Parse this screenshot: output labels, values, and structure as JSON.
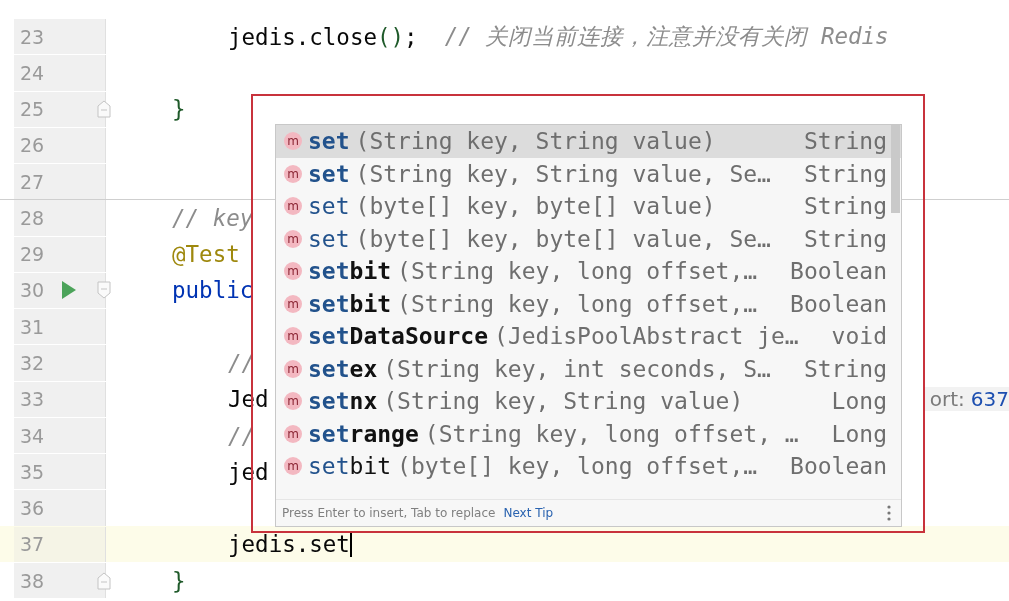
{
  "editor": {
    "lines": [
      {
        "number": "23",
        "kind": "body",
        "current": false,
        "caret": false,
        "separator": false,
        "tokens": [
          {
            "kind": "plain",
            "text": "jedis.close"
          },
          {
            "kind": "paren",
            "text": "()"
          },
          {
            "kind": "plain",
            "text": ";"
          },
          {
            "kind": "comment",
            "text": "// 关闭当前连接，注意并没有关闭 Redis"
          }
        ]
      },
      {
        "number": "24",
        "kind": "blank",
        "current": false,
        "caret": false,
        "separator": false
      },
      {
        "number": "25",
        "kind": "member",
        "current": false,
        "caret": false,
        "separator": false,
        "gutter": [
          {
            "kind": "fold_end"
          }
        ],
        "tokens": [
          {
            "kind": "paren",
            "text": "}"
          }
        ]
      },
      {
        "number": "26",
        "kind": "blank",
        "current": false,
        "caret": false,
        "separator": false
      },
      {
        "number": "27",
        "kind": "blank",
        "current": false,
        "caret": false,
        "separator": false
      },
      {
        "number": "28",
        "kind": "member",
        "current": false,
        "caret": false,
        "separator": true,
        "tokens": [
          {
            "kind": "comment",
            "text": "// key"
          }
        ]
      },
      {
        "number": "29",
        "kind": "member",
        "current": false,
        "caret": false,
        "separator": false,
        "tokens": [
          {
            "kind": "annotation",
            "text": "@Test"
          }
        ]
      },
      {
        "number": "30",
        "kind": "member",
        "current": false,
        "caret": false,
        "separator": false,
        "gutter": [
          {
            "kind": "run"
          },
          {
            "kind": "fold_start"
          }
        ],
        "tokens": [
          {
            "kind": "keyword",
            "text": "public"
          }
        ]
      },
      {
        "number": "31",
        "kind": "blank",
        "current": false,
        "caret": false,
        "separator": false
      },
      {
        "number": "32",
        "kind": "body",
        "current": false,
        "caret": false,
        "separator": false,
        "tokens": [
          {
            "kind": "comment",
            "text": "//"
          }
        ]
      },
      {
        "number": "33",
        "kind": "body",
        "current": false,
        "caret": false,
        "separator": false,
        "tokens": [
          {
            "kind": "plain",
            "text": "Jed"
          }
        ],
        "hint": {
          "label": "ort:",
          "value": "637"
        }
      },
      {
        "number": "34",
        "kind": "body",
        "current": false,
        "caret": false,
        "separator": false,
        "tokens": [
          {
            "kind": "comment",
            "text": "//"
          }
        ]
      },
      {
        "number": "35",
        "kind": "body",
        "current": false,
        "caret": false,
        "separator": false,
        "tokens": [
          {
            "kind": "plain",
            "text": "jed"
          }
        ]
      },
      {
        "number": "36",
        "kind": "blank",
        "current": false,
        "caret": false,
        "separator": false
      },
      {
        "number": "37",
        "kind": "body",
        "current": true,
        "caret": true,
        "separator": false,
        "tokens": [
          {
            "kind": "plain",
            "text": "jedis.set"
          }
        ]
      },
      {
        "number": "38",
        "kind": "member",
        "current": false,
        "caret": false,
        "separator": false,
        "gutter": [
          {
            "kind": "fold_end"
          }
        ],
        "tokens": [
          {
            "kind": "paren",
            "text": "}"
          }
        ]
      }
    ]
  },
  "completion": {
    "items": [
      {
        "icon": "m",
        "match": "set",
        "params": "(String key, String value)",
        "type": "String",
        "bold": true,
        "selected": true
      },
      {
        "icon": "m",
        "match": "set",
        "params": "(String key, String value, Se…",
        "type": "String",
        "bold": true,
        "selected": false
      },
      {
        "icon": "m",
        "match": "set",
        "params": "(byte[] key, byte[] value)",
        "type": "String",
        "bold": false,
        "selected": false
      },
      {
        "icon": "m",
        "match": "set",
        "params": "(byte[] key, byte[] value, Se…",
        "type": "String",
        "bold": false,
        "selected": false
      },
      {
        "icon": "m",
        "match": "set",
        "rest": "bit",
        "params": "(String key, long offset,…",
        "type": "Boolean",
        "bold": true,
        "selected": false
      },
      {
        "icon": "m",
        "match": "set",
        "rest": "bit",
        "params": "(String key, long offset,…",
        "type": "Boolean",
        "bold": true,
        "selected": false
      },
      {
        "icon": "m",
        "match": "set",
        "rest": "DataSource",
        "params": "(JedisPoolAbstract je…",
        "type": "void",
        "bold": true,
        "selected": false
      },
      {
        "icon": "m",
        "match": "set",
        "rest": "ex",
        "params": "(String key, int seconds, S…",
        "type": "String",
        "bold": true,
        "selected": false
      },
      {
        "icon": "m",
        "match": "set",
        "rest": "nx",
        "params": "(String key, String value)",
        "type": "Long",
        "bold": true,
        "selected": false
      },
      {
        "icon": "m",
        "match": "set",
        "rest": "range",
        "params": "(String key, long offset, …",
        "type": "Long",
        "bold": true,
        "selected": false
      },
      {
        "icon": "m",
        "match": "set",
        "rest": "bit",
        "params": "(byte[] key, long offset,…",
        "type": "Boolean",
        "bold": false,
        "selected": false
      }
    ],
    "footer": {
      "hint": "Press Enter to insert, Tab to replace",
      "link": "Next Tip"
    }
  }
}
